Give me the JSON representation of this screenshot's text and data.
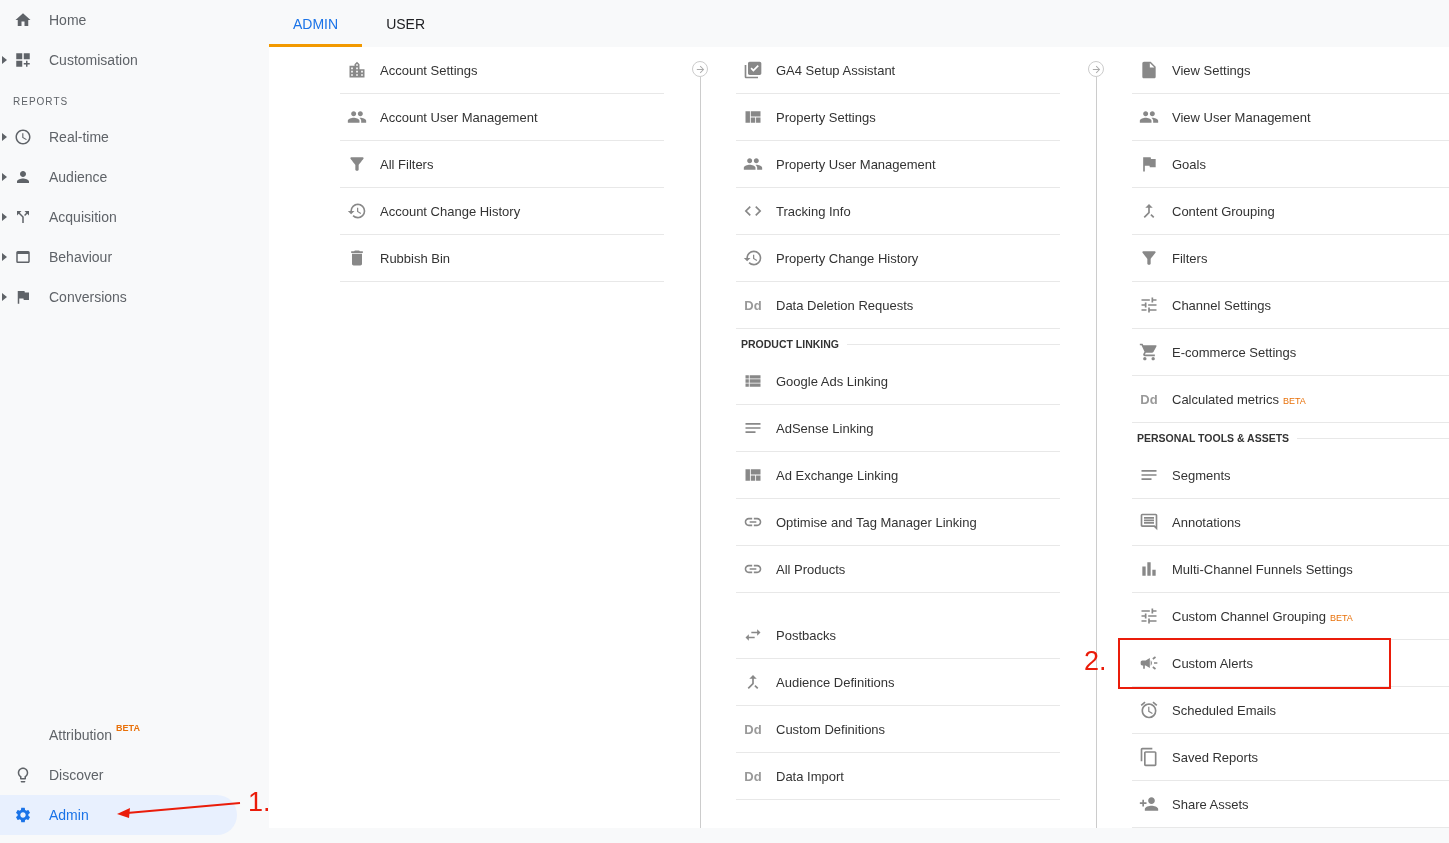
{
  "sidebar": {
    "top_items": [
      {
        "label": "Home",
        "kind": "home",
        "expandable": false,
        "selected": false
      },
      {
        "label": "Customisation",
        "kind": "dashboard",
        "expandable": true,
        "selected": false
      }
    ],
    "section_title": "REPORTS",
    "report_items": [
      {
        "label": "Real-time",
        "kind": "clock",
        "expandable": true,
        "selected": false
      },
      {
        "label": "Audience",
        "kind": "person",
        "expandable": true,
        "selected": false
      },
      {
        "label": "Acquisition",
        "kind": "split",
        "expandable": true,
        "selected": false
      },
      {
        "label": "Behaviour",
        "kind": "window",
        "expandable": true,
        "selected": false
      },
      {
        "label": "Conversions",
        "kind": "flag",
        "expandable": true,
        "selected": false
      }
    ],
    "bottom_items": [
      {
        "label": "Attribution",
        "badge": "BETA",
        "kind": "none",
        "expandable": false,
        "selected": false
      },
      {
        "label": "Discover",
        "kind": "bulb",
        "expandable": false,
        "selected": false
      },
      {
        "label": "Admin",
        "kind": "gear",
        "expandable": false,
        "selected": true,
        "annotation": "1."
      }
    ]
  },
  "tabs": [
    {
      "label": "ADMIN",
      "selected": true
    },
    {
      "label": "USER",
      "selected": false
    }
  ],
  "columns": [
    {
      "groups": [
        {
          "items": [
            {
              "label": "Account Settings",
              "kind": "building"
            },
            {
              "label": "Account User Management",
              "kind": "people"
            },
            {
              "label": "All Filters",
              "kind": "funnel"
            },
            {
              "label": "Account Change History",
              "kind": "history"
            },
            {
              "label": "Rubbish Bin",
              "kind": "bin"
            }
          ]
        }
      ]
    },
    {
      "groups": [
        {
          "items": [
            {
              "label": "GA4 Setup Assistant",
              "kind": "checkbox"
            },
            {
              "label": "Property Settings",
              "kind": "layout"
            },
            {
              "label": "Property User Management",
              "kind": "people"
            },
            {
              "label": "Tracking Info",
              "kind": "code"
            },
            {
              "label": "Property Change History",
              "kind": "history"
            },
            {
              "label": "Data Deletion Requests",
              "kind": "letters",
              "glyph": "Dd"
            }
          ]
        },
        {
          "title": "PRODUCT LINKING",
          "items": [
            {
              "label": "Google Ads Linking",
              "kind": "ads"
            },
            {
              "label": "AdSense Linking",
              "kind": "adsense"
            },
            {
              "label": "Ad Exchange Linking",
              "kind": "layout"
            },
            {
              "label": "Optimise and Tag Manager Linking",
              "kind": "link"
            },
            {
              "label": "All Products",
              "kind": "link"
            }
          ]
        },
        {
          "items": [
            {
              "label": "Postbacks",
              "kind": "swap"
            },
            {
              "label": "Audience Definitions",
              "kind": "merge"
            },
            {
              "label": "Custom Definitions",
              "kind": "letters",
              "glyph": "Dd"
            },
            {
              "label": "Data Import",
              "kind": "letters",
              "glyph": "Dd"
            }
          ]
        }
      ]
    },
    {
      "groups": [
        {
          "items": [
            {
              "label": "View Settings",
              "kind": "page"
            },
            {
              "label": "View User Management",
              "kind": "people"
            },
            {
              "label": "Goals",
              "kind": "flag"
            },
            {
              "label": "Content Grouping",
              "kind": "group"
            },
            {
              "label": "Filters",
              "kind": "funnel"
            },
            {
              "label": "Channel Settings",
              "kind": "channels"
            },
            {
              "label": "E-commerce Settings",
              "kind": "cart"
            },
            {
              "label": "Calculated metrics",
              "badge": "BETA",
              "kind": "letters",
              "glyph": "Dd"
            }
          ]
        },
        {
          "title": "PERSONAL TOOLS & ASSETS",
          "items": [
            {
              "label": "Segments",
              "kind": "segments"
            },
            {
              "label": "Annotations",
              "kind": "comment"
            },
            {
              "label": "Multi-Channel Funnels Settings",
              "kind": "bars"
            },
            {
              "label": "Custom Channel Grouping",
              "badge": "BETA",
              "kind": "channels"
            },
            {
              "label": "Custom Alerts",
              "kind": "megaphone",
              "annotation": "2."
            },
            {
              "label": "Scheduled Emails",
              "kind": "alarm"
            },
            {
              "label": "Saved Reports",
              "kind": "copy"
            },
            {
              "label": "Share Assets",
              "kind": "adduser"
            }
          ]
        }
      ]
    }
  ]
}
